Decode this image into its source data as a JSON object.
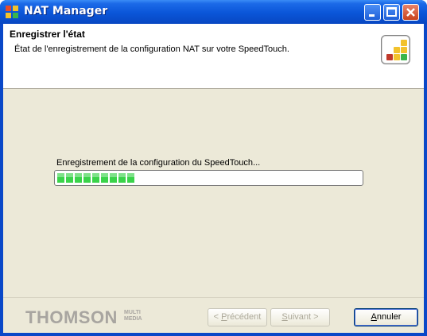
{
  "window": {
    "title": "NAT Manager"
  },
  "header": {
    "title": "Enregistrer l'état",
    "subtitle": "État de l'enregistrement de la configuration NAT sur votre SpeedTouch."
  },
  "progress": {
    "label": "Enregistrement de la configuration du SpeedTouch...",
    "fraction": 0.25,
    "color": "#3ad34a"
  },
  "footer": {
    "brand": "THOMSON",
    "brand_sub": "MULTI MEDIA",
    "prev_prefix": "< ",
    "prev_access": "P",
    "prev_rest": "récédent",
    "next_access": "S",
    "next_rest": "uivant >",
    "cancel_access": "A",
    "cancel_rest": "nnuler"
  }
}
